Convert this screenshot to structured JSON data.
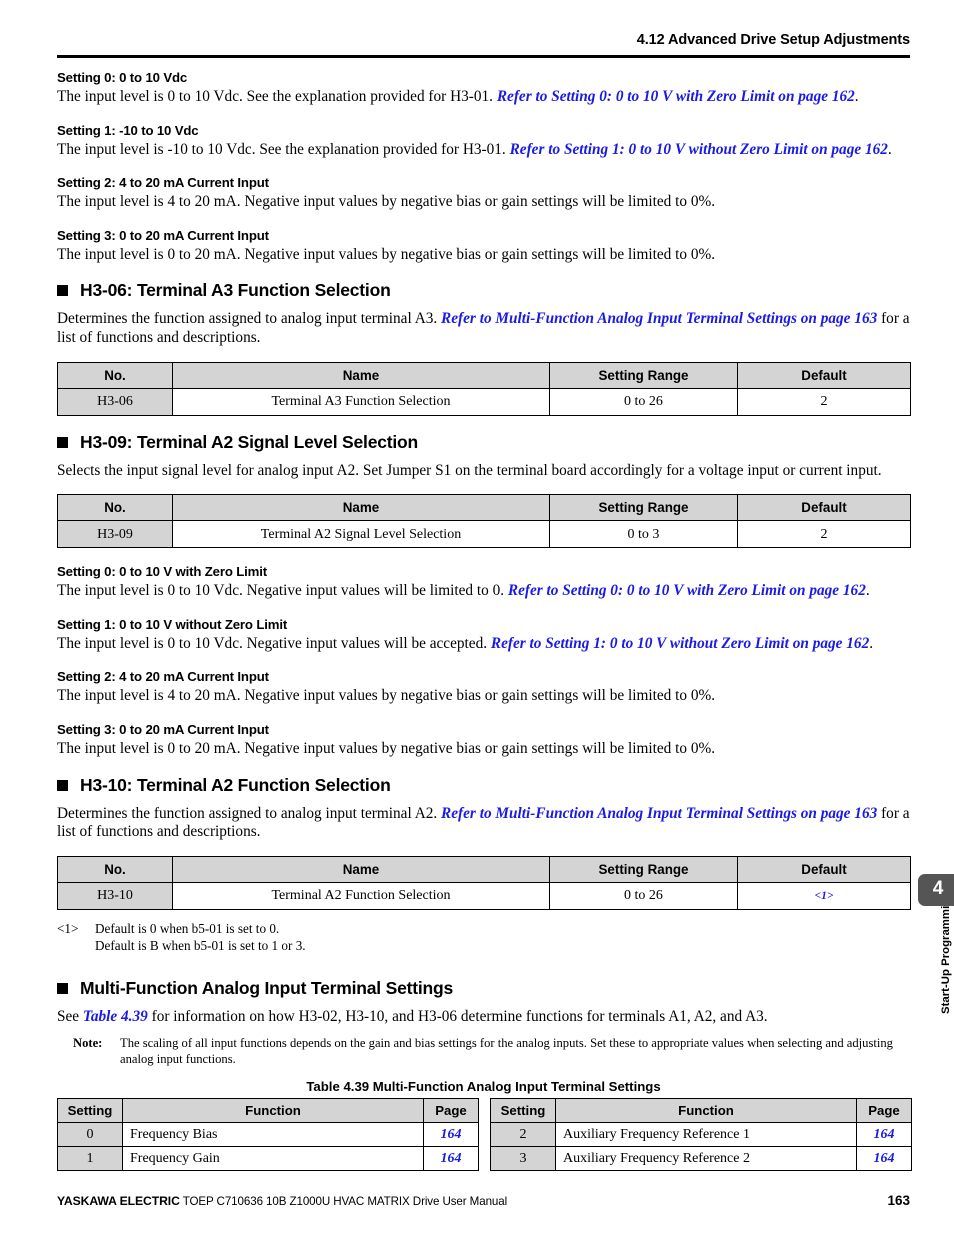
{
  "header": {
    "title": "4.12 Advanced Drive Setup Adjustments"
  },
  "settings_group_a": [
    {
      "heading": "Setting 0: 0 to 10 Vdc",
      "body_before": "The input level is 0 to 10 Vdc. See the explanation provided for H3-01. ",
      "xref": "Refer to Setting 0: 0 to 10 V with Zero Limit on page 162",
      "body_after": "."
    },
    {
      "heading": "Setting 1: -10 to 10 Vdc",
      "body_before": "The input level is -10 to 10 Vdc. See the explanation provided for H3-01. ",
      "xref": "Refer to Setting 1: 0 to 10 V without Zero Limit on page 162",
      "body_after": "."
    },
    {
      "heading": "Setting 2: 4 to 20 mA Current Input",
      "body_before": "The input level is 4 to 20 mA. Negative input values by negative bias or gain settings will be limited to 0%.",
      "xref": "",
      "body_after": ""
    },
    {
      "heading": "Setting 3: 0 to 20 mA Current Input",
      "body_before": "The input level is 0 to 20 mA. Negative input values by negative bias or gain settings will be limited to 0%.",
      "xref": "",
      "body_after": ""
    }
  ],
  "section_h306": {
    "heading": "H3-06: Terminal A3 Function Selection",
    "body_before": "Determines the function assigned to analog input terminal A3. ",
    "xref": "Refer to Multi-Function Analog Input Terminal Settings on page 163",
    "body_after": " for a list of functions and descriptions.",
    "table": {
      "columns": [
        "No.",
        "Name",
        "Setting Range",
        "Default"
      ],
      "row": {
        "no": "H3-06",
        "name": "Terminal A3 Function Selection",
        "range": "0 to 26",
        "default": "2"
      }
    }
  },
  "section_h309": {
    "heading": "H3-09: Terminal A2 Signal Level Selection",
    "body": "Selects the input signal level for analog input A2. Set Jumper S1 on the terminal board accordingly for a voltage input or current input.",
    "table": {
      "columns": [
        "No.",
        "Name",
        "Setting Range",
        "Default"
      ],
      "row": {
        "no": "H3-09",
        "name": "Terminal A2 Signal Level Selection",
        "range": "0 to 3",
        "default": "2"
      }
    }
  },
  "settings_group_b": [
    {
      "heading": "Setting 0: 0 to 10 V with Zero Limit",
      "body_before": "The input level is 0 to 10 Vdc. Negative input values will be limited to 0. ",
      "xref": "Refer to Setting 0: 0 to 10 V with Zero Limit on page 162",
      "body_after": "."
    },
    {
      "heading": "Setting 1: 0 to 10 V without Zero Limit",
      "body_before": "The input level is 0 to 10 Vdc. Negative input values will be accepted. ",
      "xref": "Refer to Setting 1: 0 to 10 V without Zero Limit on page 162",
      "body_after": "."
    },
    {
      "heading": "Setting 2: 4 to 20 mA Current Input",
      "body_before": "The input level is 4 to 20 mA. Negative input values by negative bias or gain settings will be limited to 0%.",
      "xref": "",
      "body_after": ""
    },
    {
      "heading": "Setting 3: 0 to 20 mA Current Input",
      "body_before": "The input level is 0 to 20 mA. Negative input values by negative bias or gain settings will be limited to 0%.",
      "xref": "",
      "body_after": ""
    }
  ],
  "section_h310": {
    "heading": "H3-10: Terminal A2 Function Selection",
    "body_before": "Determines the function assigned to analog input terminal A2. ",
    "xref": "Refer to Multi-Function Analog Input Terminal Settings on page 163",
    "body_after": " for a list of functions and descriptions.",
    "table": {
      "columns": [
        "No.",
        "Name",
        "Setting Range",
        "Default"
      ],
      "row": {
        "no": "H3-10",
        "name": "Terminal A2 Function Selection",
        "range": "0 to 26",
        "default": "<1>"
      }
    },
    "footnote": {
      "mark": "<1>",
      "line1": "Default is 0 when b5-01 is set to 0.",
      "line2": "Default is B when b5-01 is set to 1 or 3."
    }
  },
  "section_mfa": {
    "heading": "Multi-Function Analog Input Terminal Settings",
    "body_before": "See ",
    "xref": "Table 4.39",
    "body_after": " for information on how H3-02, H3-10, and H3-06 determine functions for terminals A1, A2, and A3.",
    "note_label": "Note:",
    "note_body": "The scaling of all input functions depends on the gain and bias settings for the analog inputs. Set these to appropriate values when selecting and adjusting analog input functions.",
    "caption": "Table 4.39  Multi-Function Analog Input Terminal Settings",
    "columns": [
      "Setting",
      "Function",
      "Page"
    ],
    "rows_left": [
      {
        "setting": "0",
        "function": "Frequency Bias",
        "page": "164"
      },
      {
        "setting": "1",
        "function": "Frequency Gain",
        "page": "164"
      }
    ],
    "rows_right": [
      {
        "setting": "2",
        "function": "Auxiliary Frequency Reference 1",
        "page": "164"
      },
      {
        "setting": "3",
        "function": "Auxiliary Frequency Reference 2",
        "page": "164"
      }
    ]
  },
  "side_tab": {
    "label": "Start-Up Programming\n& Operation",
    "chapter": "4"
  },
  "footer": {
    "brand": "YASKAWA ELECTRIC",
    "manual": " TOEP C710636 10B Z1000U HVAC MATRIX Drive User Manual",
    "page": "163"
  },
  "colors": {
    "xref_blue": "#1a1ae6",
    "table_header_gray": "#d4d4d4",
    "tab_gray": "#555555"
  }
}
